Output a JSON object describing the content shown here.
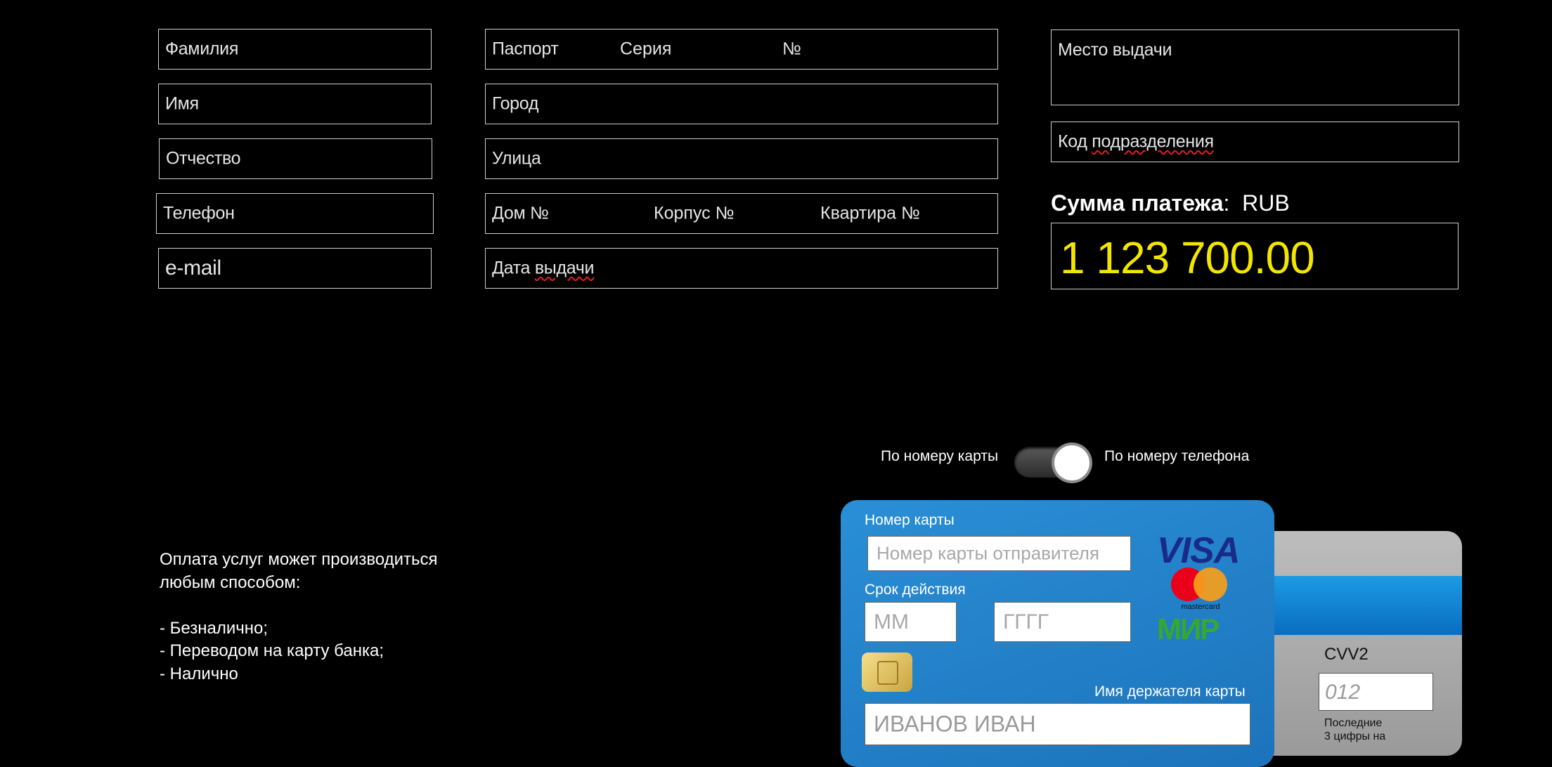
{
  "fields": {
    "surname": "Фамилия",
    "name": "Имя",
    "patronymic": "Отчество",
    "phone": "Телефон",
    "email": "e-mail",
    "passport": "Паспорт",
    "series": "Серия",
    "number": "№",
    "city": "Город",
    "street": "Улица",
    "house": "Дом №",
    "building": "Корпус №",
    "apartment": "Квартира №",
    "issue_date_prefix": "Дата ",
    "issue_date_word": "выдачи",
    "issue_place": "Место выдачи",
    "dept_code_prefix": "Код ",
    "dept_code_word": "подразделения"
  },
  "payment": {
    "label": "Сумма платежа",
    "colon": ":",
    "currency": "RUB",
    "amount": "1 123 700.00"
  },
  "switch": {
    "left_label": "По номеру карты",
    "right_label": "По номеру телефона"
  },
  "info": {
    "line1": "Оплата услуг может производиться",
    "line2": "любым способом:",
    "item1": "- Безналично;",
    "item2": "- Переводом на карту банка;",
    "item3": "- Налично"
  },
  "card": {
    "number_label": "Номер карты",
    "number_placeholder": "Номер карты отправителя",
    "expiry_label": "Срок действия",
    "month_placeholder": "ММ",
    "year_placeholder": "ГГГГ",
    "holder_label": "Имя держателя карты",
    "holder_value": "ИВАНОВ ИВАН",
    "visa_text": "VISA",
    "mastercard_text": "mastercard",
    "mir_text": "МИР"
  },
  "back_card": {
    "cvv_label": "CVV2",
    "cvv_placeholder": "012",
    "cvv_help_line1": "Последние",
    "cvv_help_line2": "3 цифры на"
  },
  "colors": {
    "amount": "#f2e600",
    "card_blue": "#2a8fd6",
    "background": "#000000"
  }
}
